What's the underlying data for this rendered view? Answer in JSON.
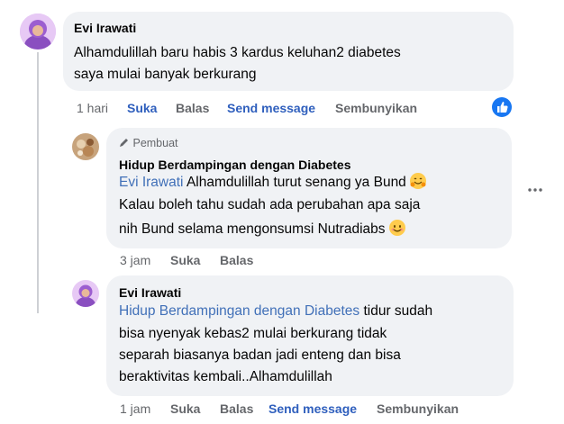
{
  "comment1": {
    "author": "Evi Irawati",
    "text_line1": "Alhamdulillah baru habis 3 kardus keluhan2 diabetes",
    "text_line2": "saya mulai banyak berkurang",
    "time": "1 hari",
    "like": "Suka",
    "reply": "Balas",
    "send": "Send message",
    "hide": "Sembunyikan",
    "reaction_icon": "like-thumb-icon"
  },
  "reply1": {
    "badge": "Pembuat",
    "author": "Hidup Berdampingan dengan Diabetes",
    "mention": "Evi Irawati",
    "line1_rest": " Alhamdulillah turut senang ya Bund",
    "line2": "Kalau boleh tahu sudah ada perubahan apa saja",
    "line3": "nih Bund selama mengonsumsi Nutradiabs",
    "time": "3 jam",
    "like": "Suka",
    "reply": "Balas",
    "more_icon": "more-dots-icon"
  },
  "reply2": {
    "author": "Evi Irawati",
    "mention": "Hidup Berdampingan dengan Diabetes",
    "line1_rest": " tidur sudah",
    "line2": "bisa nyenyak kebas2 mulai berkurang tidak",
    "line3": "separah biasanya badan jadi enteng dan bisa",
    "line4": "beraktivitas kembali..Alhamdulillah",
    "time": "1 jam",
    "like": "Suka",
    "reply": "Balas",
    "send": "Send message",
    "hide": "Sembunyikan"
  },
  "colors": {
    "bubble": "#f0f2f5",
    "mention": "#4170b8",
    "link_blue": "#2f5fbd",
    "meta_gray": "#65676b",
    "like_blue": "#1877f2"
  }
}
